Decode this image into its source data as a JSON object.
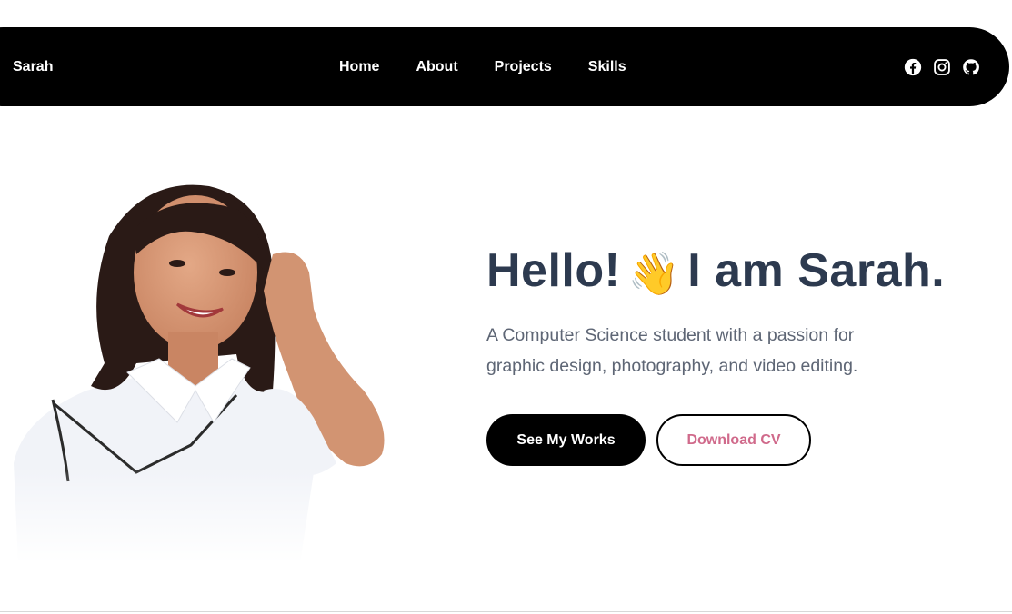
{
  "nav": {
    "brand": "Sarah",
    "links": [
      "Home",
      "About",
      "Projects",
      "Skills"
    ],
    "socials": [
      "facebook-icon",
      "instagram-icon",
      "github-icon"
    ]
  },
  "hero": {
    "title_before": "Hello!",
    "wave_emoji": "👋",
    "title_after": "I am Sarah.",
    "subtitle": "A Computer Science student with a passion for graphic design, photography, and video editing.",
    "primary_button": "See My Works",
    "secondary_button": "Download CV"
  },
  "colors": {
    "nav_bg": "#000000",
    "title": "#2d3a4f",
    "subtitle": "#5e6675",
    "accent_pink": "#d06a8b"
  }
}
